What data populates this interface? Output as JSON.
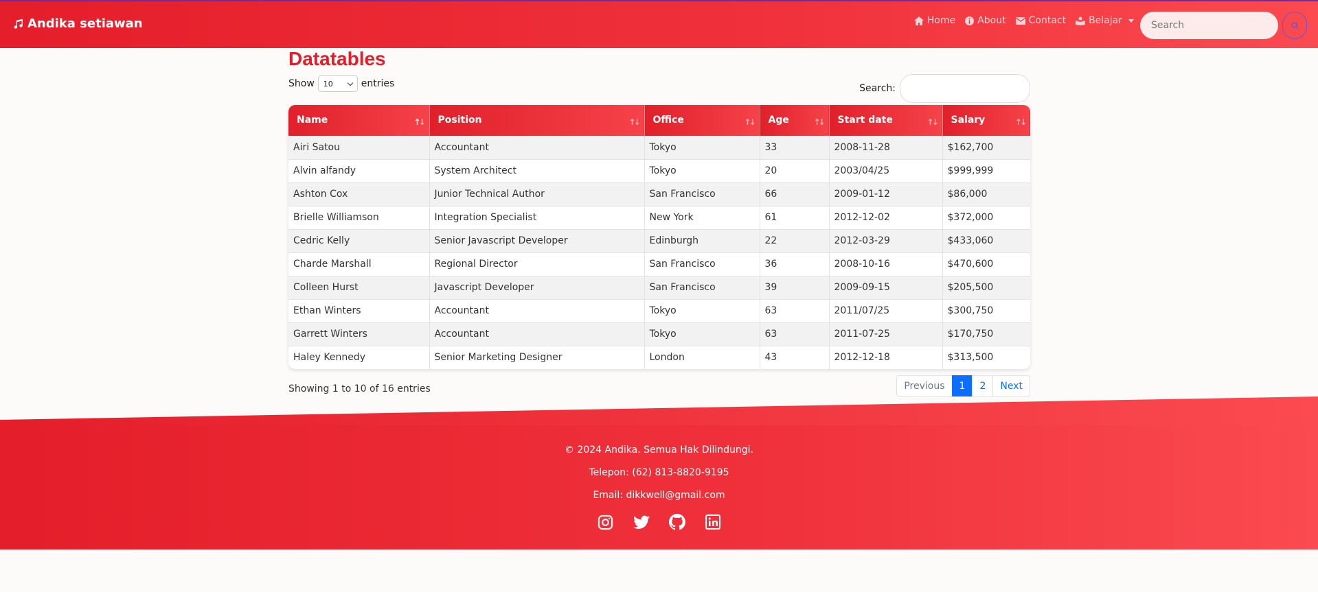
{
  "navbar": {
    "brand": "Andika setiawan",
    "brand_icon": "music-note-icon",
    "links": [
      {
        "label": "Home",
        "icon": "home-icon"
      },
      {
        "label": "About",
        "icon": "info-icon"
      },
      {
        "label": "Contact",
        "icon": "envelope-icon"
      },
      {
        "label": "Belajar",
        "icon": "book-icon"
      }
    ],
    "search_placeholder": "Search"
  },
  "page": {
    "title": "Datatables",
    "show_label": "Show",
    "entries_value": "10",
    "entries_label": "entries",
    "search_label": "Search:"
  },
  "table": {
    "columns": [
      "Name",
      "Position",
      "Office",
      "Age",
      "Start date",
      "Salary"
    ],
    "rows": [
      [
        "Airi Satou",
        "Accountant",
        "Tokyo",
        "33",
        "2008-11-28",
        "$162,700"
      ],
      [
        "Alvin alfandy",
        "System Architect",
        "Tokyo",
        "20",
        "2003/04/25",
        "$999,999"
      ],
      [
        "Ashton Cox",
        "Junior Technical Author",
        "San Francisco",
        "66",
        "2009-01-12",
        "$86,000"
      ],
      [
        "Brielle Williamson",
        "Integration Specialist",
        "New York",
        "61",
        "2012-12-02",
        "$372,000"
      ],
      [
        "Cedric Kelly",
        "Senior Javascript Developer",
        "Edinburgh",
        "22",
        "2012-03-29",
        "$433,060"
      ],
      [
        "Charde Marshall",
        "Regional Director",
        "San Francisco",
        "36",
        "2008-10-16",
        "$470,600"
      ],
      [
        "Colleen Hurst",
        "Javascript Developer",
        "San Francisco",
        "39",
        "2009-09-15",
        "$205,500"
      ],
      [
        "Ethan Winters",
        "Accountant",
        "Tokyo",
        "63",
        "2011/07/25",
        "$300,750"
      ],
      [
        "Garrett Winters",
        "Accountant",
        "Tokyo",
        "63",
        "2011-07-25",
        "$170,750"
      ],
      [
        "Haley Kennedy",
        "Senior Marketing Designer",
        "London",
        "43",
        "2012-12-18",
        "$313,500"
      ]
    ],
    "info": "Showing 1 to 10 of 16 entries",
    "pagination": {
      "previous": "Previous",
      "pages": [
        "1",
        "2"
      ],
      "next": "Next",
      "active": "1"
    }
  },
  "footer": {
    "copyright": "© 2024 Andika. Semua Hak Dilindungi.",
    "phone": "Telepon: (62) 813-8820-9195",
    "email": "Email: dikkwell@gmail.com",
    "socials": [
      "instagram-icon",
      "twitter-icon",
      "github-icon",
      "linkedin-icon"
    ]
  },
  "colors": {
    "primary": "#e41e2a",
    "accent": "#fb4a50",
    "link": "#0d6efd"
  }
}
